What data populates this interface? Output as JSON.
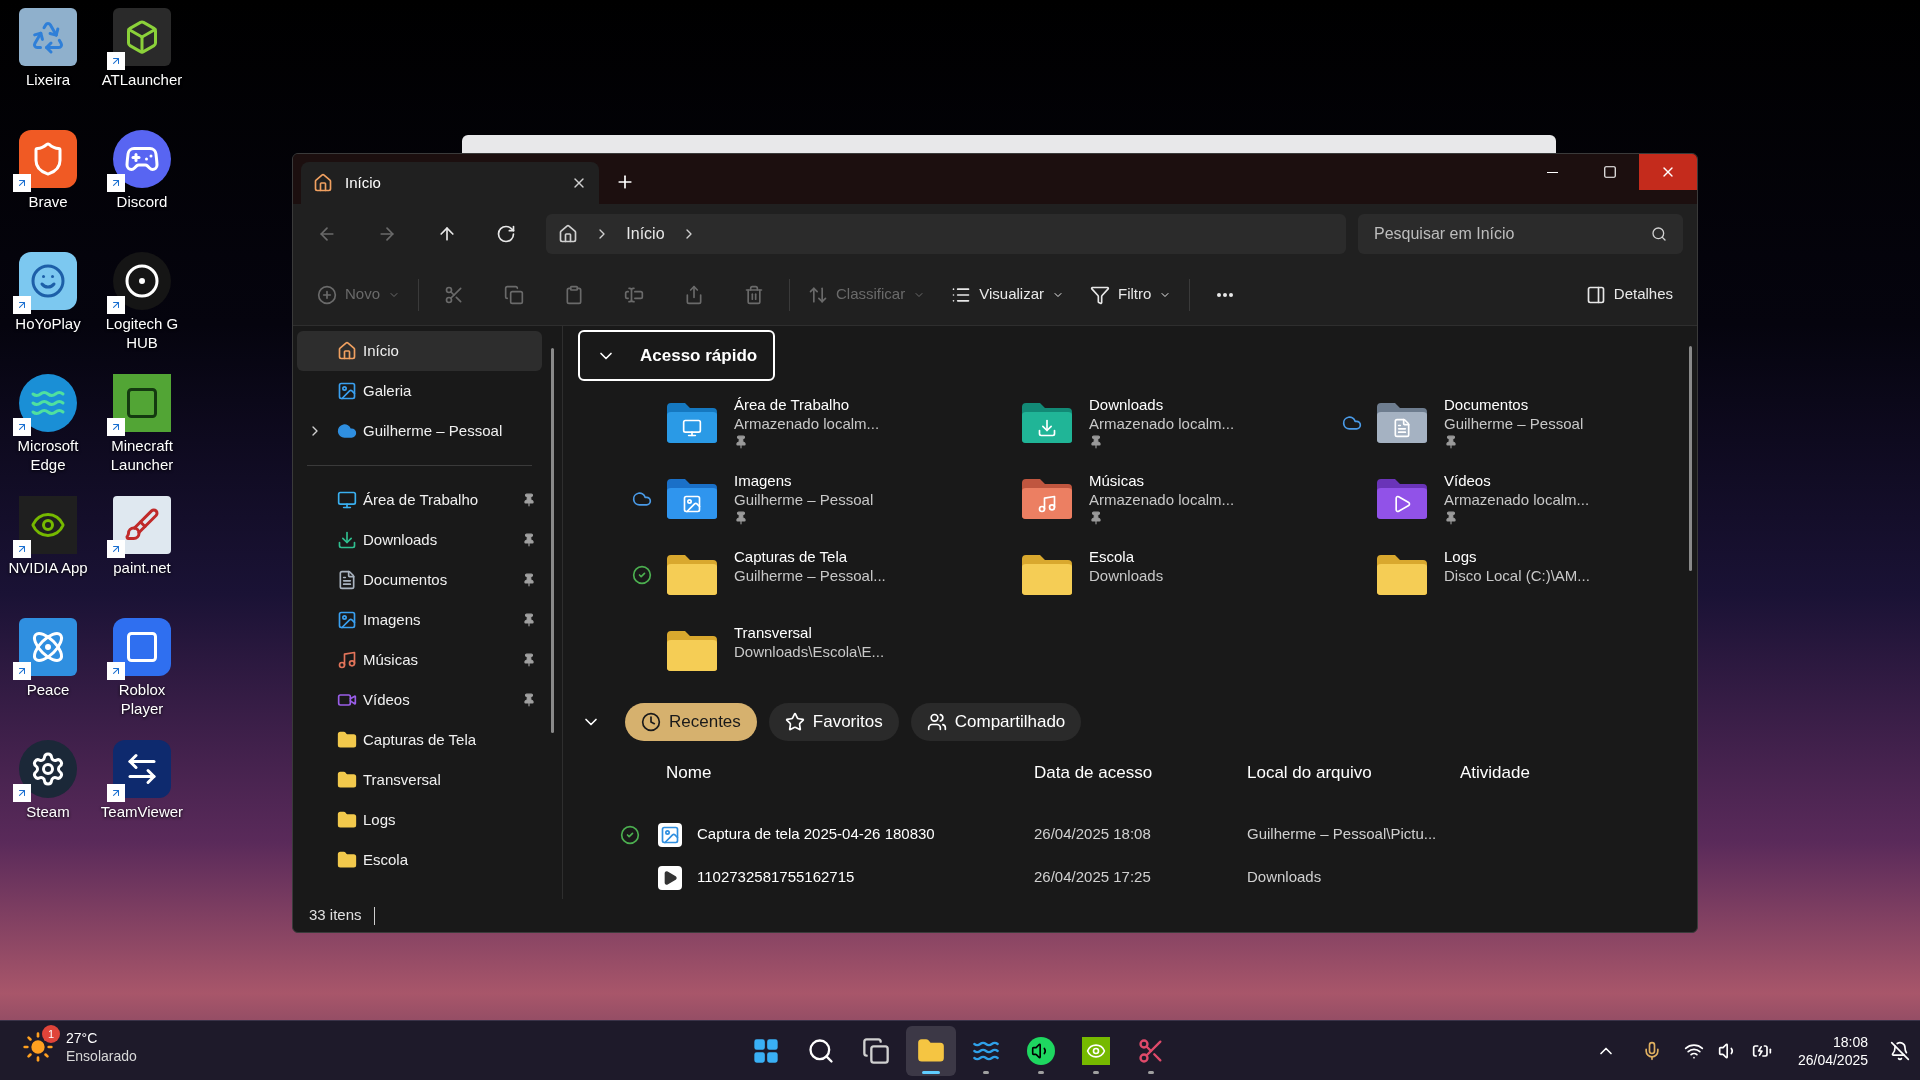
{
  "desktop_icons": [
    {
      "label": "Lixeira",
      "shortcut": false
    },
    {
      "label": "ATLauncher",
      "shortcut": true
    },
    {
      "label": "Brave",
      "shortcut": true
    },
    {
      "label": "Discord",
      "shortcut": true
    },
    {
      "label": "HoYoPlay",
      "shortcut": true
    },
    {
      "label": "Logitech G HUB",
      "shortcut": true
    },
    {
      "label": "Microsoft Edge",
      "shortcut": true
    },
    {
      "label": "Minecraft Launcher",
      "shortcut": true
    },
    {
      "label": "NVIDIA App",
      "shortcut": true
    },
    {
      "label": "paint.net",
      "shortcut": true
    },
    {
      "label": "Peace",
      "shortcut": true
    },
    {
      "label": "Roblox Player",
      "shortcut": true
    },
    {
      "label": "Steam",
      "shortcut": true
    },
    {
      "label": "TeamViewer",
      "shortcut": true
    }
  ],
  "window": {
    "tabs": [
      {
        "label": "Início",
        "selected": true
      }
    ],
    "window_controls": [
      {
        "kind": "minimize",
        "hovered": false
      },
      {
        "kind": "maximize",
        "hovered": false
      },
      {
        "kind": "close",
        "hovered": true
      }
    ],
    "nav": [
      {
        "kind": "back",
        "disabled": true
      },
      {
        "kind": "forward",
        "disabled": true
      },
      {
        "kind": "up",
        "disabled": false
      },
      {
        "kind": "refresh",
        "disabled": false
      }
    ],
    "address": {
      "crumbs": [
        "Início"
      ]
    },
    "search": {
      "placeholder": "Pesquisar em Início"
    },
    "toolbar": [
      [
        {
          "kind": "menu",
          "label": "Novo",
          "disabled": true
        }
      ],
      [
        {
          "kind": "icon",
          "disabled": true
        },
        {
          "kind": "icon",
          "disabled": true
        },
        {
          "kind": "icon",
          "disabled": true
        },
        {
          "kind": "icon",
          "disabled": true
        },
        {
          "kind": "icon",
          "disabled": true
        },
        {
          "kind": "icon",
          "disabled": true
        }
      ],
      [
        {
          "kind": "menu",
          "label": "Classificar",
          "disabled": true
        },
        {
          "kind": "menu",
          "label": "Visualizar",
          "disabled": false
        },
        {
          "kind": "menu",
          "label": "Filtro",
          "disabled": false
        }
      ],
      [
        {
          "kind": "more",
          "disabled": false
        }
      ]
    ],
    "details_button": "Detalhes",
    "sidebar": {
      "top": [
        {
          "label": "Início",
          "kind": "home",
          "selected": true
        },
        {
          "label": "Galeria",
          "kind": "gallery",
          "selected": false
        },
        {
          "label": "Guilherme – Pessoal",
          "kind": "cloud",
          "selected": false,
          "expanded": false
        }
      ],
      "pinned": [
        {
          "label": "Área de Trabalho",
          "kind": "desktop",
          "selected": false,
          "pinned": true
        },
        {
          "label": "Downloads",
          "kind": "downloads",
          "selected": false,
          "pinned": true
        },
        {
          "label": "Documentos",
          "kind": "documents",
          "selected": false,
          "pinned": true
        },
        {
          "label": "Imagens",
          "kind": "pictures",
          "selected": false,
          "pinned": true
        },
        {
          "label": "Músicas",
          "kind": "music",
          "selected": false,
          "pinned": true
        },
        {
          "label": "Vídeos",
          "kind": "videos",
          "selected": false,
          "pinned": true
        },
        {
          "label": "Capturas de Tela",
          "kind": "folder",
          "selected": false,
          "pinned": false
        },
        {
          "label": "Transversal",
          "kind": "folder",
          "selected": false,
          "pinned": false
        },
        {
          "label": "Logs",
          "kind": "folder",
          "selected": false,
          "pinned": false
        },
        {
          "label": "Escola",
          "kind": "folder",
          "selected": false,
          "pinned": false
        }
      ]
    },
    "quick_access": {
      "title": "Acesso rápido",
      "expanded": true,
      "items": [
        {
          "name": "Área de Trabalho",
          "subtitle": "Armazenado localm...",
          "kind": "desktop",
          "cloud": false,
          "synced": false,
          "pinned": true
        },
        {
          "name": "Downloads",
          "subtitle": "Armazenado localm...",
          "kind": "downloads",
          "cloud": false,
          "synced": false,
          "pinned": true
        },
        {
          "name": "Documentos",
          "subtitle": "Guilherme – Pessoal",
          "kind": "documents",
          "cloud": true,
          "synced": false,
          "pinned": true
        },
        {
          "name": "Imagens",
          "subtitle": "Guilherme – Pessoal",
          "kind": "pictures",
          "cloud": true,
          "synced": false,
          "pinned": true
        },
        {
          "name": "Músicas",
          "subtitle": "Armazenado localm...",
          "kind": "music",
          "cloud": false,
          "synced": false,
          "pinned": true
        },
        {
          "name": "Vídeos",
          "subtitle": "Armazenado localm...",
          "kind": "videos",
          "cloud": false,
          "synced": false,
          "pinned": true
        },
        {
          "name": "Capturas de Tela",
          "subtitle": "Guilherme – Pessoal...",
          "kind": "folder",
          "cloud": false,
          "synced": true,
          "pinned": false
        },
        {
          "name": "Escola",
          "subtitle": "Downloads",
          "kind": "folder",
          "cloud": false,
          "synced": false,
          "pinned": false
        },
        {
          "name": "Logs",
          "subtitle": "Disco Local (C:)\\AM...",
          "kind": "folder",
          "cloud": false,
          "synced": false,
          "pinned": false
        },
        {
          "name": "Transversal",
          "subtitle": "Downloads\\Escola\\E...",
          "kind": "folder",
          "cloud": false,
          "synced": false,
          "pinned": false
        }
      ]
    },
    "recent": {
      "expanded": true,
      "filters": [
        {
          "label": "Recentes",
          "selected": true
        },
        {
          "label": "Favoritos",
          "selected": false
        },
        {
          "label": "Compartilhado",
          "selected": false
        }
      ],
      "columns": [
        "Nome",
        "Data de acesso",
        "Local do arquivo",
        "Atividade"
      ],
      "rows": [
        {
          "name": "Captura de tela 2025-04-26 180830",
          "date": "26/04/2025 18:08",
          "location": "Guilherme – Pessoal\\Pictu...",
          "kind": "image",
          "synced": true
        },
        {
          "name": "1102732581755162715",
          "date": "26/04/2025 17:25",
          "location": "Downloads",
          "kind": "video",
          "synced": false
        }
      ]
    },
    "status_bar": {
      "count": "33 itens"
    }
  },
  "taskbar": {
    "weather": {
      "temperature": "27°C",
      "condition": "Ensolarado",
      "badge": "1"
    },
    "apps": [
      {
        "kind": "start",
        "active": false,
        "running": false
      },
      {
        "kind": "search",
        "active": false,
        "running": false
      },
      {
        "kind": "taskview",
        "active": false,
        "running": false
      },
      {
        "kind": "explorer",
        "active": true,
        "running": true
      },
      {
        "kind": "edge",
        "active": false,
        "running": true
      },
      {
        "kind": "spotify",
        "active": false,
        "running": true
      },
      {
        "kind": "nvidia",
        "active": false,
        "running": true
      },
      {
        "kind": "snipping",
        "active": false,
        "running": true
      }
    ],
    "time": "18:08",
    "date": "26/04/2025"
  }
}
